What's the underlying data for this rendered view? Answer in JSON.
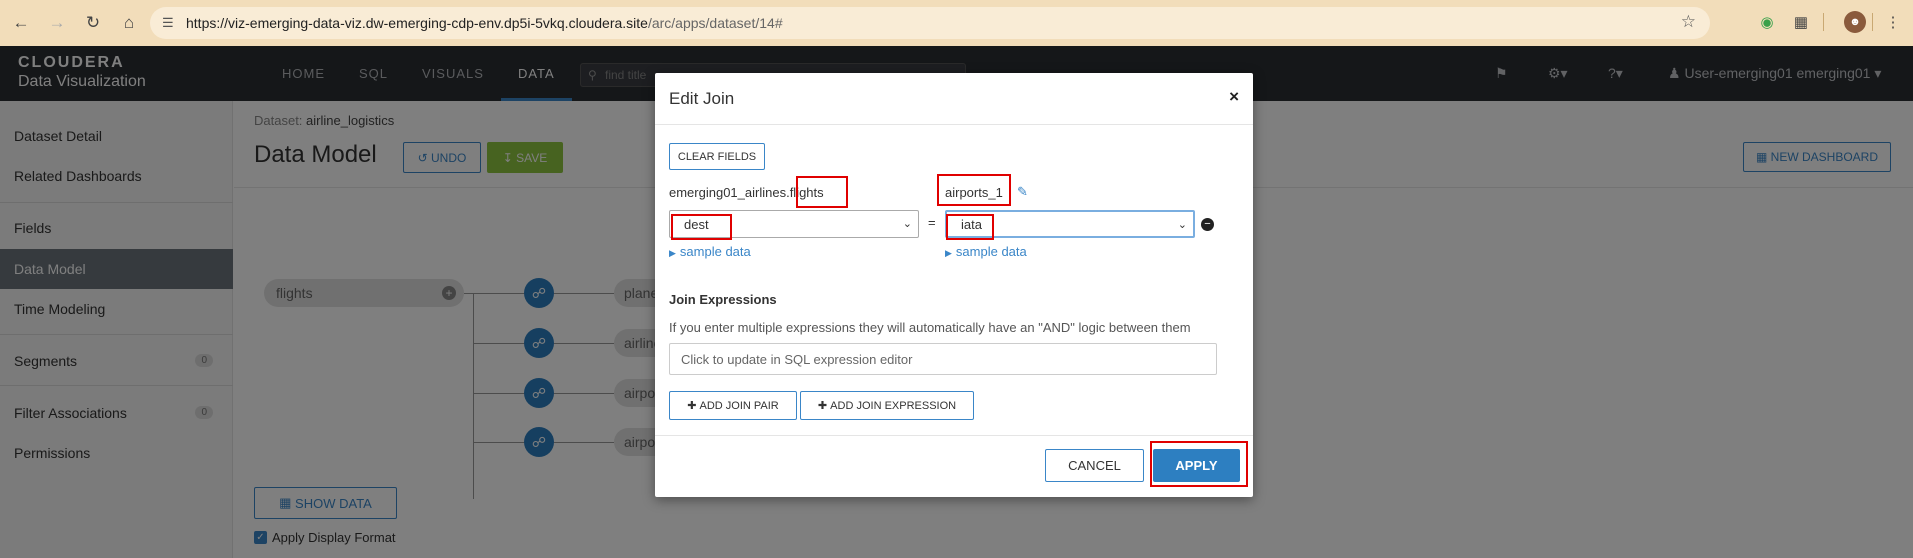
{
  "browser": {
    "url_main": "https://viz-emerging-data-viz.dw-emerging-cdp-env.dp5i-5vkq.cloudera.site",
    "url_path": "/arc/apps/dataset/14#"
  },
  "header": {
    "logo_top": "CLOUDERA",
    "logo_bottom": "Data Visualization",
    "nav": [
      "HOME",
      "SQL",
      "VISUALS",
      "DATA"
    ],
    "search_placeholder": "find title",
    "user": "User-emerging01 emerging01"
  },
  "sidebar": {
    "items": [
      "Dataset Detail",
      "Related Dashboards",
      "Fields",
      "Data Model",
      "Time Modeling",
      "Segments",
      "Filter Associations",
      "Permissions"
    ],
    "segments_count": "0",
    "filter_count": "0"
  },
  "main": {
    "crumb_label": "Dataset:",
    "crumb_value": "airline_logistics",
    "title": "Data Model",
    "undo_label": "UNDO",
    "save_label": "SAVE",
    "new_dashboard_label": "NEW DASHBOARD",
    "main_node": "flights",
    "child_nodes": [
      "planes",
      "airlines",
      "airports",
      "airports"
    ],
    "show_data_label": "SHOW DATA",
    "apply_format_label": "Apply Display Format"
  },
  "modal": {
    "title": "Edit Join",
    "clear_fields_label": "CLEAR FIELDS",
    "left_table_prefix": "emerging01_airlines.",
    "left_table_name": "flights",
    "right_table": "airports_1",
    "left_field": "dest",
    "right_field": "iata",
    "equals": "=",
    "sample_data_label": "sample data",
    "join_expressions_title": "Join Expressions",
    "join_expressions_desc": "If you enter multiple expressions they will automatically have an \"AND\" logic between them",
    "expression_placeholder": "Click to update in SQL expression editor",
    "add_join_pair_label": "ADD JOIN PAIR",
    "add_join_expression_label": "ADD JOIN EXPRESSION",
    "cancel_label": "CANCEL",
    "apply_label": "APPLY"
  },
  "colors": {
    "accent": "#2d7fc1",
    "save_green": "#8fc641",
    "header_bg": "#2b2e33",
    "highlight": "#e00000"
  }
}
